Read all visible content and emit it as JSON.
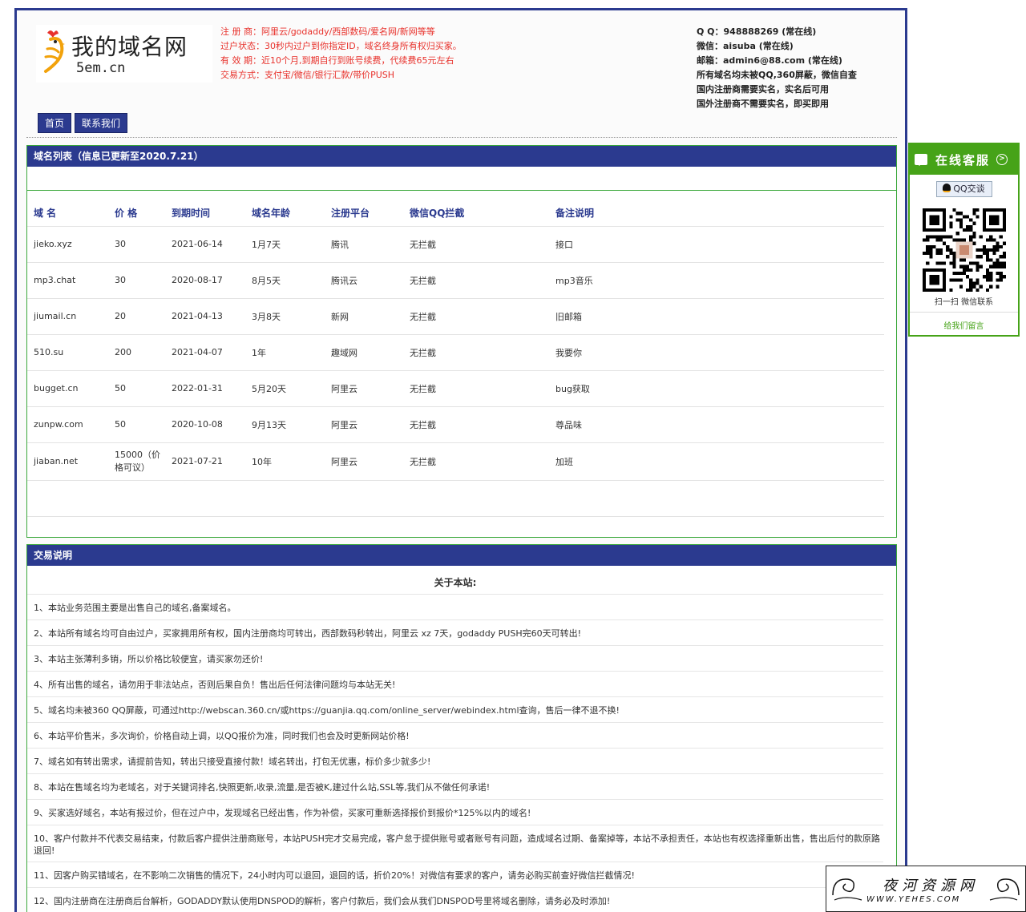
{
  "header": {
    "logo_title": "我的域名网",
    "logo_sub": "5em.cn",
    "notice_lines": [
      "注 册 商：阿里云/godaddy/西部数码/爱名网/新网等等",
      "过户状态：30秒内过户到你指定ID，域名终身所有权归买家。",
      "有 效 期：近10个月,到期自行到账号续费，代续费65元左右",
      "交易方式：支付宝/微信/银行汇款/带价PUSH"
    ],
    "contact_lines": [
      "Q Q：948888269 (常在线)",
      "微信：aisuba (常在线)",
      "邮箱：admin6@88.com (常在线)",
      "所有域名均未被QQ,360屏蔽，微信自查",
      "国内注册商需要实名，实名后可用",
      "国外注册商不需要实名，即买即用"
    ]
  },
  "nav": {
    "home": "首页",
    "contact": "联系我们"
  },
  "domain_panel": {
    "title": "域名列表（信息已更新至2020.7.21）",
    "columns": [
      "域 名",
      "价 格",
      "到期时间",
      "域名年龄",
      "注册平台",
      "微信QQ拦截",
      "备注说明"
    ],
    "rows": [
      [
        "jieko.xyz",
        "30",
        "2021-06-14",
        "1月7天",
        "腾讯",
        "无拦截",
        "接口"
      ],
      [
        "mp3.chat",
        "30",
        "2020-08-17",
        "8月5天",
        "腾讯云",
        "无拦截",
        "mp3音乐"
      ],
      [
        "jiumail.cn",
        "20",
        "2021-04-13",
        "3月8天",
        "新网",
        "无拦截",
        "旧邮箱"
      ],
      [
        "510.su",
        "200",
        "2021-04-07",
        "1年",
        "趣域网",
        "无拦截",
        "我要你"
      ],
      [
        "bugget.cn",
        "50",
        "2022-01-31",
        "5月20天",
        "阿里云",
        "无拦截",
        "bug获取"
      ],
      [
        "zunpw.com",
        "50",
        "2020-10-08",
        "9月13天",
        "阿里云",
        "无拦截",
        "尊品味"
      ],
      [
        "jiaban.net",
        "15000（价格可议）",
        "2021-07-21",
        "10年",
        "阿里云",
        "无拦截",
        "加班"
      ]
    ]
  },
  "trade_panel": {
    "title": "交易说明",
    "subtitle": "关于本站:",
    "items": [
      "1、本站业务范围主要是出售自己的域名,备案域名。",
      "2、本站所有域名均可自由过户，买家拥用所有权，国内注册商均可转出，西部数码秒转出，阿里云 xz 7天，godaddy PUSH完60天可转出!",
      "3、本站主张薄利多销，所以价格比较便宜，请买家勿还价!",
      "4、所有出售的域名，请勿用于非法站点，否则后果自负！售出后任何法律问题均与本站无关!",
      "5、域名均未被360 QQ屏蔽，可通过http://webscan.360.cn/或https://guanjia.qq.com/online_server/webindex.html查询，售后一律不退不换!",
      "6、本站平价售米，多次询价，价格自动上调，以QQ报价为准，同时我们也会及时更新网站价格!",
      "7、域名如有转出需求，请提前告知，转出只接受直接付款！域名转出，打包无优惠，标价多少就多少!",
      "8、本站在售域名均为老域名，对于关键词排名,快照更新,收录,流量,是否被K,建过什么站,SSL等,我们从不做任何承诺!",
      "9、买家选好域名，本站有报过价，但在过户中，发现域名已经出售，作为补偿，买家可重新选择报价到报价*125%以内的域名!",
      "10、客户付款并不代表交易结束，付款后客户提供注册商账号，本站PUSH完才交易完成，客户怠于提供账号或者账号有问题，造成域名过期、备案掉等，本站不承担责任，本站也有权选择重新出售，售出后付的款原路退回!",
      "11、因客户购买错域名，在不影响二次销售的情况下，24小时内可以退回，退回的话，折价20%！对微信有要求的客户，请务必购买前查好微信拦截情况!",
      "12、国内注册商在注册商后台解析，GODADDY默认使用DNSPOD的解析，客户付款后，我们会从我们DNSPOD号里将域名删除，请务必及时添加!"
    ]
  },
  "service": {
    "title": "在线客服",
    "qq_button": "QQ交谈",
    "qr_caption": "扫一扫 微信联系",
    "leave_message": "给我们留言",
    "accent": "#46a318"
  },
  "watermark": {
    "title": "夜河资源网",
    "url": "WWW.YEHES.COM"
  },
  "colors": {
    "navy": "#2b3a8f",
    "notice_red": "#e8312b",
    "panel_green": "#3aa83a"
  }
}
